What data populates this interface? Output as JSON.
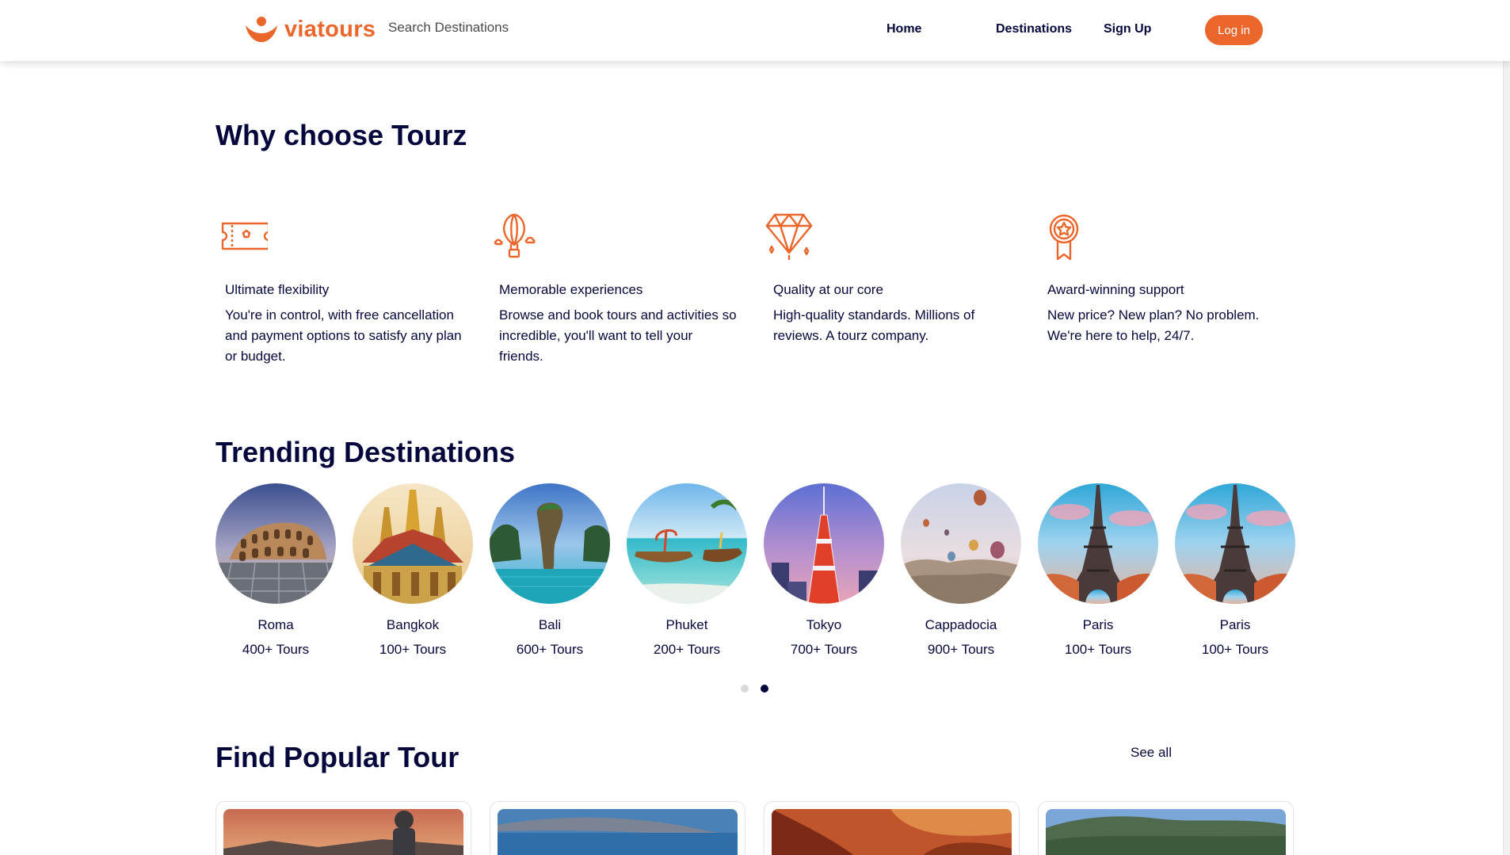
{
  "header": {
    "logo_text": "viatours",
    "search_placeholder": "Search Destinations",
    "nav": {
      "home": "Home",
      "destinations": "Destinations",
      "signup": "Sign Up"
    },
    "login_label": "Log in"
  },
  "why": {
    "title": "Why choose Tourz",
    "features": [
      {
        "icon": "ticket-icon",
        "title": "Ultimate flexibility",
        "desc": "You're in control, with free cancellation and payment options to satisfy any plan or budget."
      },
      {
        "icon": "hot-air-balloon-icon",
        "title": "Memorable experiences",
        "desc": "Browse and book tours and activities so incredible, you'll want to tell your friends."
      },
      {
        "icon": "diamond-icon",
        "title": "Quality at our core",
        "desc": "High-quality standards. Millions of reviews. A tourz company."
      },
      {
        "icon": "award-ribbon-icon",
        "title": "Award-winning support",
        "desc": "New price? New plan? No problem. We're here to help, 24/7."
      }
    ]
  },
  "trending": {
    "title": "Trending Destinations",
    "items": [
      {
        "name": "Roma",
        "count": "400+ Tours"
      },
      {
        "name": "Bangkok",
        "count": "100+ Tours"
      },
      {
        "name": "Bali",
        "count": "600+ Tours"
      },
      {
        "name": "Phuket",
        "count": "200+ Tours"
      },
      {
        "name": "Tokyo",
        "count": "700+ Tours"
      },
      {
        "name": "Cappadocia",
        "count": "900+ Tours"
      },
      {
        "name": "Paris",
        "count": "100+ Tours"
      },
      {
        "name": "Paris",
        "count": "100+ Tours"
      }
    ],
    "active_page": 2,
    "page_count": 2
  },
  "popular": {
    "title": "Find Popular Tour",
    "see_all": "See all"
  },
  "colors": {
    "accent": "#eb662b",
    "navy": "#05073c"
  }
}
